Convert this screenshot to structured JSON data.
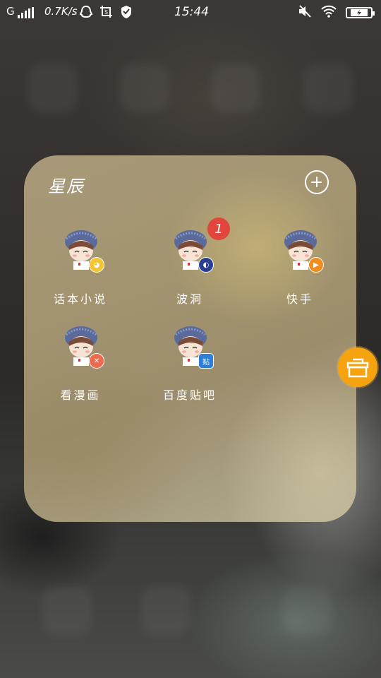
{
  "status_bar": {
    "network_type": "G",
    "speed": "0.7K/s",
    "time": "15:44",
    "icons": [
      "signal-icon",
      "qq-icon",
      "screenshot-icon",
      "vpn-shield-icon",
      "mute-icon",
      "wifi-icon",
      "battery-charging-icon"
    ]
  },
  "folder": {
    "title": "星辰",
    "add_icon": "plus-circle-icon",
    "apps": [
      {
        "label": "话本小说",
        "badge_icon": "huaben-mini-icon",
        "badge_color": "#f4c431",
        "notification": ""
      },
      {
        "label": "波洞",
        "badge_icon": "bodong-mini-icon",
        "badge_color": "#2b3f8f",
        "notification": "1"
      },
      {
        "label": "快手",
        "badge_icon": "kuaishou-mini-icon",
        "badge_color": "#f08d1c",
        "notification": ""
      },
      {
        "label": "看漫画",
        "badge_icon": "kanmanhua-mini-icon",
        "badge_color": "#ee6a4f",
        "notification": ""
      },
      {
        "label": "百度贴吧",
        "badge_icon": "tieba-mini-icon",
        "badge_color": "#2d7ed6",
        "notification": "",
        "badge_text": "贴"
      }
    ]
  },
  "floating_button": {
    "icon": "toolbox-icon",
    "color": "#f5a30f"
  }
}
